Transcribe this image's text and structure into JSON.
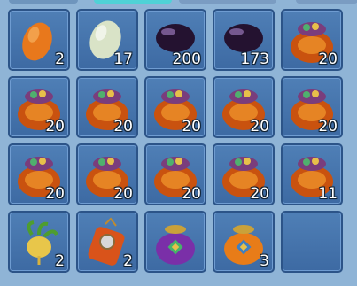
{
  "inventory": {
    "slots": [
      {
        "item": "orange-egg-icon",
        "qty": "2"
      },
      {
        "item": "pearl-egg-icon",
        "qty": "17"
      },
      {
        "item": "black-gem-icon",
        "qty": "200"
      },
      {
        "item": "black-gem-icon",
        "qty": "173"
      },
      {
        "item": "treasure-bag-icon",
        "qty": "20"
      },
      {
        "item": "treasure-bag-icon",
        "qty": "20"
      },
      {
        "item": "treasure-bag-icon",
        "qty": "20"
      },
      {
        "item": "treasure-bag-icon",
        "qty": "20"
      },
      {
        "item": "treasure-bag-icon",
        "qty": "20"
      },
      {
        "item": "treasure-bag-icon",
        "qty": "20"
      },
      {
        "item": "treasure-bag-icon",
        "qty": "20"
      },
      {
        "item": "treasure-bag-icon",
        "qty": "20"
      },
      {
        "item": "treasure-bag-icon",
        "qty": "20"
      },
      {
        "item": "treasure-bag-icon",
        "qty": "20"
      },
      {
        "item": "treasure-bag-icon",
        "qty": "11"
      },
      {
        "item": "golden-radish-icon",
        "qty": "2"
      },
      {
        "item": "medal-pouch-icon",
        "qty": "2"
      },
      {
        "item": "purple-pouch-icon",
        "qty": ""
      },
      {
        "item": "orange-pouch-icon",
        "qty": "3"
      },
      {
        "item": "",
        "qty": ""
      }
    ]
  },
  "colors": {
    "background": "#8fb4d6",
    "slot": "#4f7fb6",
    "slot_border": "#2c5488",
    "active_tab": "#4fd2d6"
  }
}
